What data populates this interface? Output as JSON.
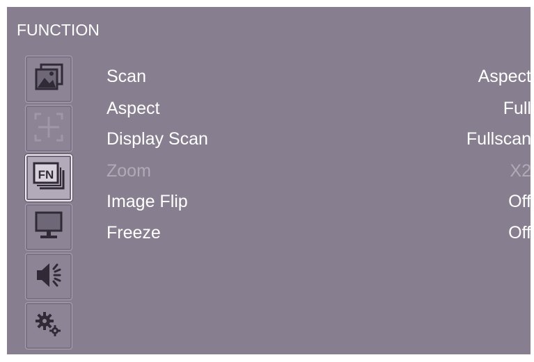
{
  "menu": {
    "title": "FUNCTION",
    "items": [
      {
        "label": "Scan",
        "value": "Aspect",
        "enabled": true
      },
      {
        "label": "Aspect",
        "value": "Full",
        "enabled": true
      },
      {
        "label": "Display Scan",
        "value": "Fullscan",
        "enabled": true
      },
      {
        "label": "Zoom",
        "value": "X2",
        "enabled": false
      },
      {
        "label": "Image Flip",
        "value": "Off",
        "enabled": true
      },
      {
        "label": "Freeze",
        "value": "Off",
        "enabled": true
      }
    ]
  },
  "sidebar": {
    "items": [
      {
        "icon": "picture-icon",
        "active": false
      },
      {
        "icon": "marker-crosshair-icon",
        "active": false
      },
      {
        "icon": "function-icon",
        "label": "FN",
        "active": true
      },
      {
        "icon": "monitor-icon",
        "active": false
      },
      {
        "icon": "speaker-icon",
        "active": false
      },
      {
        "icon": "gear-settings-icon",
        "active": false
      }
    ]
  },
  "colors": {
    "background": "#877f8f",
    "text": "#ffffff",
    "disabled_text": "#b0a9b6",
    "active_tab": "#b2aab8"
  }
}
